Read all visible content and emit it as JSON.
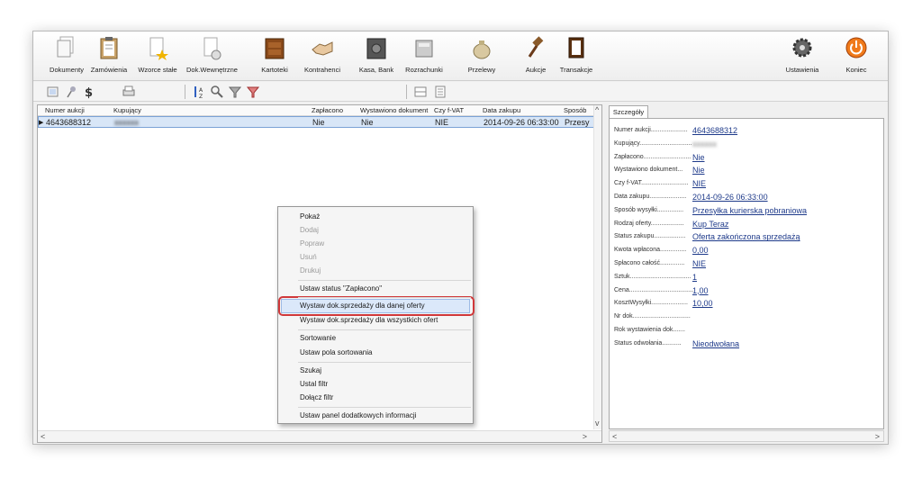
{
  "ribbon": {
    "dokumenty": "Dokumenty",
    "zamowienia": "Zamówienia",
    "wzorce": "Wzorce stałe",
    "dokwew": "Dok.Wewnętrzne",
    "kartoteki": "Kartoteki",
    "kontrahenci": "Kontrahenci",
    "kasabank": "Kasa, Bank",
    "rozrachunki": "Rozrachunki",
    "przelewy": "Przelewy",
    "aukcje": "Aukcje",
    "transakcje": "Transakcje",
    "ustawienia": "Ustawienia",
    "koniec": "Koniec"
  },
  "table": {
    "headers": {
      "numer": "Numer aukcji",
      "kupujacy": "Kupujący",
      "zaplacono": "Zapłacono",
      "wystawiono": "Wystawiono dokument",
      "czyfvat": "Czy f-VAT",
      "data": "Data zakupu",
      "sposob": "Sposób"
    },
    "row": {
      "numer": "4643688312",
      "kupujacy": "xxxxxx",
      "zaplacono": "Nie",
      "wystawiono": "Nie",
      "czyfvat": "NIE",
      "data": "2014-09-26 06:33:00",
      "sposob": "Przesy"
    }
  },
  "context_menu": {
    "pokaz": "Pokaż",
    "dodaj": "Dodaj",
    "popraw": "Popraw",
    "usun": "Usuń",
    "drukuj": "Drukuj",
    "ustaw_status": "Ustaw status \"Zapłacono\"",
    "wystaw_oferty": "Wystaw dok.sprzedaży dla danej oferty",
    "wystaw_wszystkich": "Wystaw dok.sprzedaży dla wszystkich ofert",
    "sortowanie": "Sortowanie",
    "ustaw_pola": "Ustaw pola sortowania",
    "szukaj": "Szukaj",
    "ustal_filtr": "Ustal filtr",
    "dolacz_filtr": "Dołącz filtr",
    "ustaw_panel": "Ustaw panel dodatkowych informacji"
  },
  "details": {
    "tab": "Szczegóły",
    "rows": [
      {
        "label": "Numer aukcji.....................",
        "value": "4643688312"
      },
      {
        "label": "Kupujący..............................",
        "value": "xxxxxx"
      },
      {
        "label": "Zapłacono...........................",
        "value": "Nie"
      },
      {
        "label": "Wystawiono dokument...",
        "value": "Nie"
      },
      {
        "label": "Czy f-VAT...........................",
        "value": "NIE"
      },
      {
        "label": "Data zakupu.....................",
        "value": "2014-09-26 06:33:00"
      },
      {
        "label": "Sposób wysyłki...............",
        "value": "Przesyłka kurierska pobraniowa"
      },
      {
        "label": "Rodzaj oferty...................",
        "value": "Kup Teraz"
      },
      {
        "label": "Status zakupu..................",
        "value": "Oferta zakończona sprzedażą"
      },
      {
        "label": "Kwota wpłacona...............",
        "value": "0,00"
      },
      {
        "label": "Spłacono całość..............",
        "value": "NIE"
      },
      {
        "label": "Sztuk...................................",
        "value": "1"
      },
      {
        "label": "Cena.....................................",
        "value": "1,00"
      },
      {
        "label": "KosztWysyłki.....................",
        "value": "10,00"
      },
      {
        "label": "Nr dok.................................",
        "value": ""
      },
      {
        "label": "Rok wystawienia dok.......",
        "value": ""
      },
      {
        "label": "Status odwołania...........",
        "value": "Nieodwołana"
      }
    ]
  }
}
